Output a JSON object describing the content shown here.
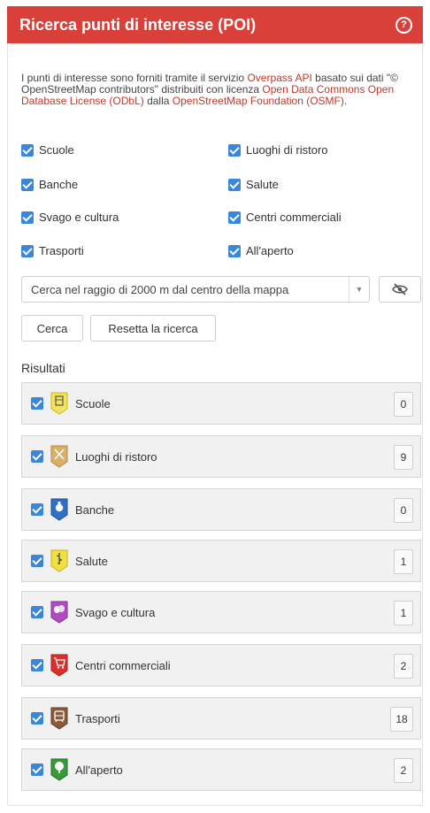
{
  "header": {
    "title": "Ricerca punti di interesse (POI)",
    "help_symbol": "?"
  },
  "info": {
    "t1": "I punti di interesse sono forniti tramite il servizio ",
    "link1": "Overpass API",
    "t2": " basato sui dati \"© OpenStreetMap contributors\" distribuiti con licenza ",
    "link2": "Open Data Commons Open Database License (ODbL)",
    "t3": " dalla ",
    "link3": "OpenStreetMap Foundation (OSMF)",
    "t4": "."
  },
  "filters": [
    {
      "label": "Scuole",
      "checked": true
    },
    {
      "label": "Luoghi di ristoro",
      "checked": true
    },
    {
      "label": "Banche",
      "checked": true
    },
    {
      "label": "Salute",
      "checked": true
    },
    {
      "label": "Svago e cultura",
      "checked": true
    },
    {
      "label": "Centri commerciali",
      "checked": true
    },
    {
      "label": "Trasporti",
      "checked": true
    },
    {
      "label": "All'aperto",
      "checked": true
    }
  ],
  "search": {
    "radius_option": "Cerca nel raggio di 2000 m dal centro della mappa"
  },
  "buttons": {
    "search": "Cerca",
    "reset": "Resetta la ricerca"
  },
  "results": {
    "title": "Risultati",
    "items": [
      {
        "label": "Scuole",
        "count": "0",
        "icon": "school-marker-icon",
        "color": "#f2e35a"
      },
      {
        "label": "Luoghi di ristoro",
        "count": "9",
        "icon": "restaurant-marker-icon",
        "color": "#d9b06a"
      },
      {
        "label": "Banche",
        "count": "0",
        "icon": "bank-marker-icon",
        "color": "#2f6fc6"
      },
      {
        "label": "Salute",
        "count": "1",
        "icon": "health-marker-icon",
        "color": "#f0e040"
      },
      {
        "label": "Svago e cultura",
        "count": "1",
        "icon": "culture-marker-icon",
        "color": "#b04cc0"
      },
      {
        "label": "Centri commerciali",
        "count": "2",
        "icon": "shopping-marker-icon",
        "color": "#d9302e"
      },
      {
        "label": "Trasporti",
        "count": "18",
        "icon": "transport-marker-icon",
        "color": "#8a5a3a"
      },
      {
        "label": "All'aperto",
        "count": "2",
        "icon": "outdoor-marker-icon",
        "color": "#3a9a3a"
      }
    ]
  }
}
